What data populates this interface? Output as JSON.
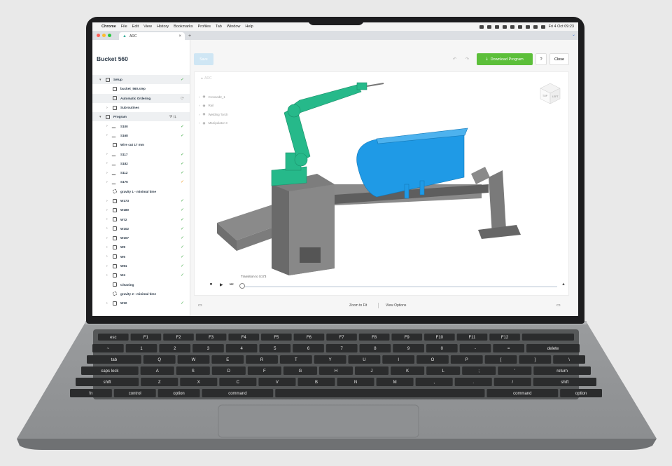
{
  "menubar": {
    "app": "Chrome",
    "items": [
      "File",
      "Edit",
      "View",
      "History",
      "Bookmarks",
      "Profiles",
      "Tab",
      "Window",
      "Help"
    ],
    "clock": "Fri 4 Oct 09:23"
  },
  "browser": {
    "tab_title": "ARC",
    "new_tab": "+"
  },
  "app": {
    "doc_title": "Bucket 560",
    "save_label": "Save",
    "download_label": "Download Program",
    "help_label": "?",
    "close_label": "Close"
  },
  "tree": [
    {
      "label": "Setup",
      "level": 0,
      "chev": "▾",
      "icon": "box",
      "check": "✓",
      "check_color": "green",
      "highlight": true
    },
    {
      "label": "bucket_560.step",
      "level": 1,
      "chev": "",
      "icon": "cube",
      "check": "",
      "check_color": "",
      "highlight": false
    },
    {
      "label": "Automatic Ordering",
      "level": 1,
      "chev": "",
      "icon": "sort",
      "check": "⟳",
      "check_color": "grey",
      "highlight": true
    },
    {
      "label": "Subroutines",
      "level": 1,
      "chev": "›",
      "icon": "box",
      "check": "",
      "check_color": "",
      "highlight": false
    },
    {
      "label": "Program",
      "level": 0,
      "chev": "▾",
      "icon": "box",
      "check": "",
      "check_color": "",
      "highlight": true,
      "tools": "⧩ ⇅"
    },
    {
      "label": "S100",
      "level": 1,
      "chev": "›",
      "icon": "run",
      "check": "✓",
      "check_color": "green",
      "highlight": false
    },
    {
      "label": "S168",
      "level": 1,
      "chev": "›",
      "icon": "run",
      "check": "✓",
      "check_color": "green",
      "highlight": false
    },
    {
      "label": "Wire cut 17 mm",
      "level": 1,
      "chev": "",
      "icon": "box",
      "check": "",
      "check_color": "",
      "highlight": false
    },
    {
      "label": "S117",
      "level": 1,
      "chev": "›",
      "icon": "run",
      "check": "✓",
      "check_color": "green",
      "highlight": false
    },
    {
      "label": "S182",
      "level": 1,
      "chev": "›",
      "icon": "run",
      "check": "✓",
      "check_color": "green",
      "highlight": false
    },
    {
      "label": "S112",
      "level": 1,
      "chev": "›",
      "icon": "run",
      "check": "✓",
      "check_color": "green",
      "highlight": false
    },
    {
      "label": "S176",
      "level": 1,
      "chev": "›",
      "icon": "run",
      "check": "✓",
      "check_color": "orange",
      "highlight": false
    },
    {
      "label": "gravity 1 - minimal time",
      "level": 1,
      "chev": "",
      "icon": "gear",
      "check": "",
      "check_color": "",
      "highlight": false
    },
    {
      "label": "W173",
      "level": 1,
      "chev": "›",
      "icon": "weld",
      "check": "✓",
      "check_color": "green",
      "highlight": false
    },
    {
      "label": "W180",
      "level": 1,
      "chev": "›",
      "icon": "weld",
      "check": "✓",
      "check_color": "green",
      "highlight": false
    },
    {
      "label": "W72",
      "level": 1,
      "chev": "›",
      "icon": "weld",
      "check": "✓",
      "check_color": "green",
      "highlight": false
    },
    {
      "label": "W102",
      "level": 1,
      "chev": "›",
      "icon": "weld",
      "check": "✓",
      "check_color": "green",
      "highlight": false
    },
    {
      "label": "W107",
      "level": 1,
      "chev": "›",
      "icon": "weld",
      "check": "✓",
      "check_color": "green",
      "highlight": false
    },
    {
      "label": "W8",
      "level": 1,
      "chev": "›",
      "icon": "weld",
      "check": "✓",
      "check_color": "green",
      "highlight": false
    },
    {
      "label": "W6",
      "level": 1,
      "chev": "›",
      "icon": "weld",
      "check": "✓",
      "check_color": "green",
      "highlight": false
    },
    {
      "label": "W81",
      "level": 1,
      "chev": "›",
      "icon": "weld",
      "check": "✓",
      "check_color": "green",
      "highlight": false
    },
    {
      "label": "W4",
      "level": 1,
      "chev": "›",
      "icon": "weld",
      "check": "✓",
      "check_color": "green",
      "highlight": false
    },
    {
      "label": "Cleaning",
      "level": 1,
      "chev": "",
      "icon": "box",
      "check": "",
      "check_color": "",
      "highlight": false
    },
    {
      "label": "gravity 2 - minimal time",
      "level": 1,
      "chev": "",
      "icon": "gear",
      "check": "",
      "check_color": "",
      "highlight": false
    },
    {
      "label": "W10",
      "level": 1,
      "chev": "›",
      "icon": "weld",
      "check": "✓",
      "check_color": "green",
      "highlight": false
    }
  ],
  "scene": {
    "items": [
      "Crossed2_1",
      "Rail",
      "Welding Torch",
      "Manipulator 3"
    ],
    "cube_faces": [
      "TOP",
      "LEFT"
    ]
  },
  "timeline": {
    "label": "Transition to S173",
    "controls": [
      "⏹",
      "▶",
      "⏭"
    ],
    "expand": "▲"
  },
  "bottombar": {
    "zoom_fit": "Zoom to Fit",
    "view_options": "View Options"
  },
  "keyboard": {
    "rows": [
      [
        "esc",
        "F1",
        "F2",
        "F3",
        "F4",
        "F5",
        "F6",
        "F7",
        "F8",
        "F9",
        "F10",
        "F11",
        "F12",
        ""
      ],
      [
        "~",
        "1",
        "2",
        "3",
        "4",
        "5",
        "6",
        "7",
        "8",
        "9",
        "0",
        "-",
        "=",
        "delete"
      ],
      [
        "tab",
        "Q",
        "W",
        "E",
        "R",
        "T",
        "Y",
        "U",
        "I",
        "O",
        "P",
        "[",
        "]",
        "\\"
      ],
      [
        "caps lock",
        "A",
        "S",
        "D",
        "F",
        "G",
        "H",
        "J",
        "K",
        "L",
        ";",
        "'",
        "return"
      ],
      [
        "shift",
        "Z",
        "X",
        "C",
        "V",
        "B",
        "N",
        "M",
        ",",
        ".",
        "/",
        "shift"
      ],
      [
        "fn",
        "control",
        "option",
        "command",
        "",
        "command",
        "option"
      ]
    ]
  },
  "colors": {
    "accent_green": "#5cbf3a",
    "robot_teal": "#26b98a",
    "bucket_blue": "#1f9ae6",
    "check_green": "#4caf50"
  }
}
